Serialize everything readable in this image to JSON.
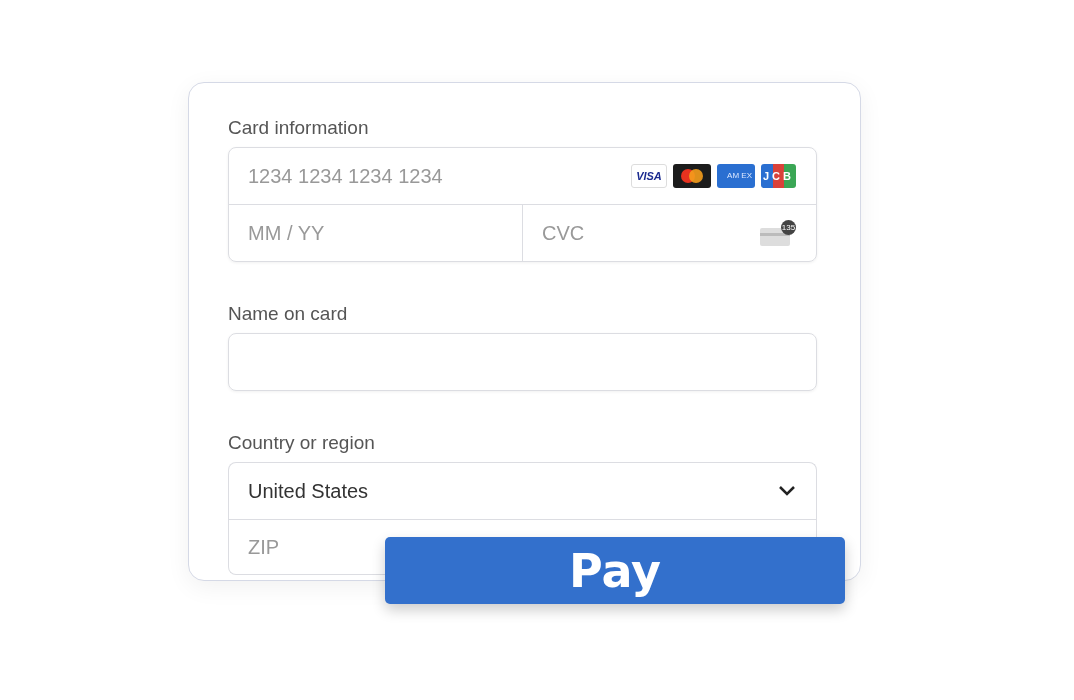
{
  "card_information": {
    "label": "Card information",
    "number": {
      "placeholder": "1234 1234 1234 1234"
    },
    "brands": [
      {
        "kind": "visa",
        "label": "VISA"
      },
      {
        "kind": "mastercard"
      },
      {
        "kind": "amex",
        "label": "AM EX"
      },
      {
        "kind": "jcb",
        "label": "JCB"
      }
    ],
    "expiry": {
      "placeholder": "MM / YY"
    },
    "cvc": {
      "placeholder": "CVC",
      "hint_badge": "135"
    }
  },
  "name_on_card": {
    "label": "Name on card"
  },
  "country": {
    "label": "Country or region",
    "value": "United States",
    "zip": {
      "placeholder": "ZIP"
    }
  },
  "pay_button": "Pay"
}
